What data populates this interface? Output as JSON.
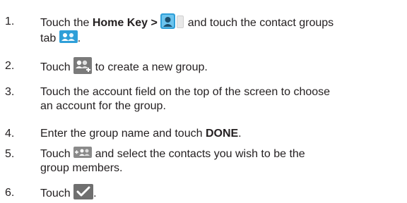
{
  "steps": [
    {
      "number": "1.",
      "line1_part1": "Touch the ",
      "line1_bold": "Home Key >",
      "line1_part2": "and touch the contact groups",
      "line2": "tab",
      "line2_end": ".",
      "icons": [
        "contacts-app-icon",
        "groups-tab-icon"
      ]
    },
    {
      "number": "2.",
      "part1": "Touch",
      "part2": "to create a new group.",
      "icons": [
        "add-group-icon"
      ]
    },
    {
      "number": "3.",
      "line1": "Touch the account field on the top of the screen to choose",
      "line2": "an account for the group."
    },
    {
      "number": "4.",
      "part1": "Enter the group name and touch ",
      "bold": "DONE",
      "end": "."
    },
    {
      "number": "5.",
      "part1": "Touch",
      "part2": "and select the contacts you wish to be the",
      "line2": "group members.",
      "icons": [
        "add-members-icon"
      ]
    },
    {
      "number": "6.",
      "part1": "Touch",
      "end": ".",
      "icons": [
        "checkmark-icon"
      ]
    }
  ],
  "colors": {
    "text": "#231f20",
    "icon_bg_blue": "#2f9fd8",
    "icon_bg_gray": "#8a8a8a",
    "icon_bg_dark": "#6f6f6f"
  }
}
